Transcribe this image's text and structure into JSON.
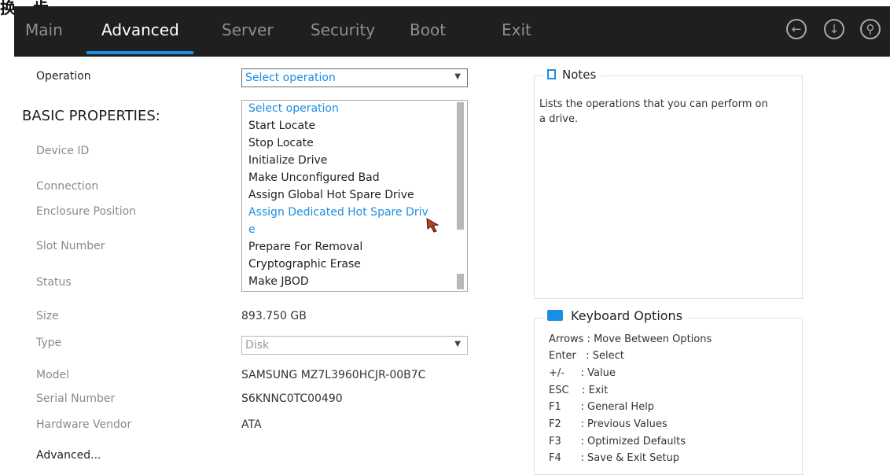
{
  "caption": "换一步",
  "nav": {
    "tabs": [
      "Main",
      "Advanced",
      "Server",
      "Security",
      "Boot",
      "Exit"
    ],
    "active_tab": "Advanced",
    "icons": [
      "back-icon",
      "save-icon",
      "search-icon"
    ]
  },
  "left": {
    "operation_label": "Operation",
    "basic_heading": "BASIC PROPERTIES:",
    "device_id_label": "Device ID",
    "connection_label": "Connection",
    "enclosure_label": "Enclosure Position",
    "slot_label": "Slot Number",
    "status_label": "Status",
    "size_label": "Size",
    "type_label": "Type",
    "model_label": "Model",
    "serial_label": "Serial Number",
    "vendor_label": "Hardware Vendor",
    "advanced_label": "Advanced..."
  },
  "values": {
    "operation_select": "Select operation",
    "size": "893.750 GB",
    "type_select": "Disk",
    "model": "SAMSUNG MZ7L3960HCJR-00B7C",
    "serial": "S6KNNC0TC00490",
    "vendor": "ATA"
  },
  "dropdown": {
    "options": [
      "Select operation",
      "Start Locate",
      "Stop Locate",
      "Initialize Drive",
      "Make Unconfigured Bad",
      "Assign Global Hot Spare Drive",
      "Assign Dedicated Hot Spare Drive",
      "Prepare For Removal",
      "Cryptographic Erase",
      "Make JBOD"
    ],
    "highlighted_line1": "Assign Dedicated Hot Spare Driv",
    "highlighted_line2": "e"
  },
  "notes": {
    "title": "Notes",
    "text": "Lists the operations that you can perform on a drive."
  },
  "keyboard": {
    "title": "Keyboard Options",
    "lines": [
      "Arrows : Move Between Options",
      "Enter   : Select",
      "+/-     : Value",
      "ESC    : Exit",
      "F1      : General Help",
      "F2      : Previous Values",
      "F3      : Optimized Defaults",
      "F4      : Save & Exit Setup"
    ]
  },
  "colors": {
    "accent": "#1a8fe3",
    "navbar": "#1f1f1f",
    "inactive_tab": "#8e8e8e"
  }
}
